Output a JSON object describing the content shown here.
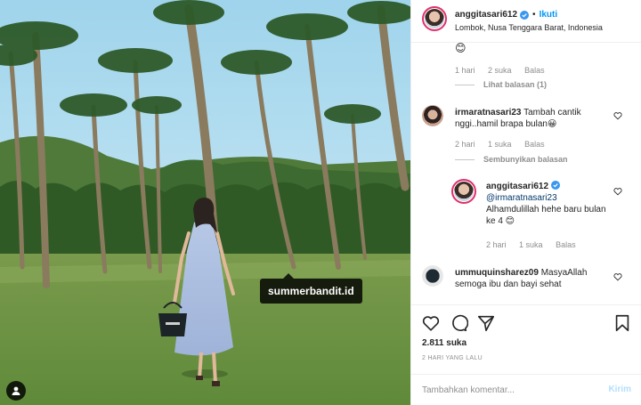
{
  "post": {
    "photo_tag": "summerbandit.id"
  },
  "header": {
    "username": "anggitasari612",
    "separator": "•",
    "follow_label": "Ikuti",
    "location": "Lombok, Nusa Tenggara Barat, Indonesia"
  },
  "comments": [
    {
      "emoji": "😊",
      "time": "1 hari",
      "likes": "2 suka",
      "reply_label": "Balas",
      "replies_toggle": "Lihat balasan (1)"
    },
    {
      "username": "irmaratnasari23",
      "text": "Tambah cantik nggi..hamil brapa bulan😀",
      "time": "2 hari",
      "likes": "1 suka",
      "reply_label": "Balas",
      "replies_toggle": "Sembunyikan balasan",
      "reply": {
        "username": "anggitasari612",
        "mention": "@irmaratnasari23",
        "text": "Alhamdulillah hehe baru bulan ke 4 😊",
        "time": "2 hari",
        "likes": "1 suka",
        "reply_label": "Balas"
      }
    },
    {
      "username": "ummuquinsharez09",
      "text": "MasyaAllah semoga ibu dan bayi sehat"
    }
  ],
  "actions": {
    "like_count": "2.811 suka",
    "timestamp": "2 HARI YANG LALU"
  },
  "composer": {
    "placeholder": "Tambahkan komentar...",
    "send_label": "Kirim"
  },
  "colors": {
    "accent": "#0095f6",
    "verified": "#3897f0",
    "send_disabled": "#b2dffc",
    "muted_text": "#8e8e8e"
  }
}
